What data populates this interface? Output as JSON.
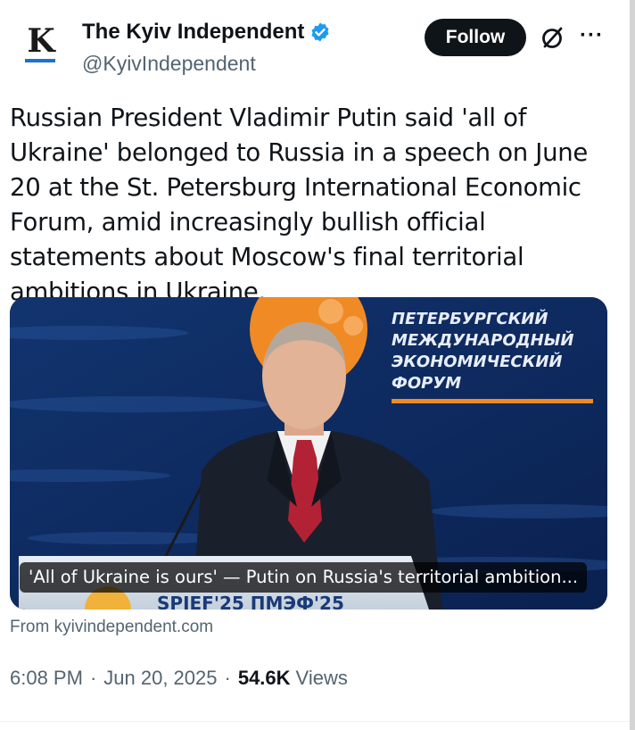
{
  "author": {
    "avatar_letter": "K",
    "name": "The Kyiv Independent",
    "handle": "@KyivIndependent",
    "verified": true
  },
  "actions": {
    "follow_label": "Follow",
    "grok_icon": "grok-slash-circle-icon",
    "more_icon": "ellipsis-icon",
    "more_glyph": "···"
  },
  "tweet": {
    "text": "Russian President Vladimir Putin said 'all of Ukraine' belonged to Russia in a speech on June 20 at the St. Petersburg International Economic Forum, amid increasingly bullish official statements about Moscow's final territorial ambitions in Ukraine."
  },
  "media": {
    "caption": "'All of Ukraine is ours' — Putin on Russia's territorial ambition...",
    "backdrop_lines": [
      "ПЕТЕРБУРГСКИЙ",
      "МЕЖДУНАРОДНЫЙ",
      "ЭКОНОМИЧЕСКИЙ",
      "ФОРУМ"
    ],
    "podium_text": "SPIEF'25  ПМЭФ'25"
  },
  "link": {
    "source": "From kyivindependent.com"
  },
  "meta": {
    "time": "6:08 PM",
    "date": "Jun 20, 2025",
    "separator": "·",
    "views_count": "54.6K",
    "views_label": "Views"
  },
  "colors": {
    "verified_blue": "#1d9bf0",
    "follow_bg": "#0f1419",
    "backdrop_blue": "#0e2a60",
    "forum_orange": "#f08a24"
  }
}
